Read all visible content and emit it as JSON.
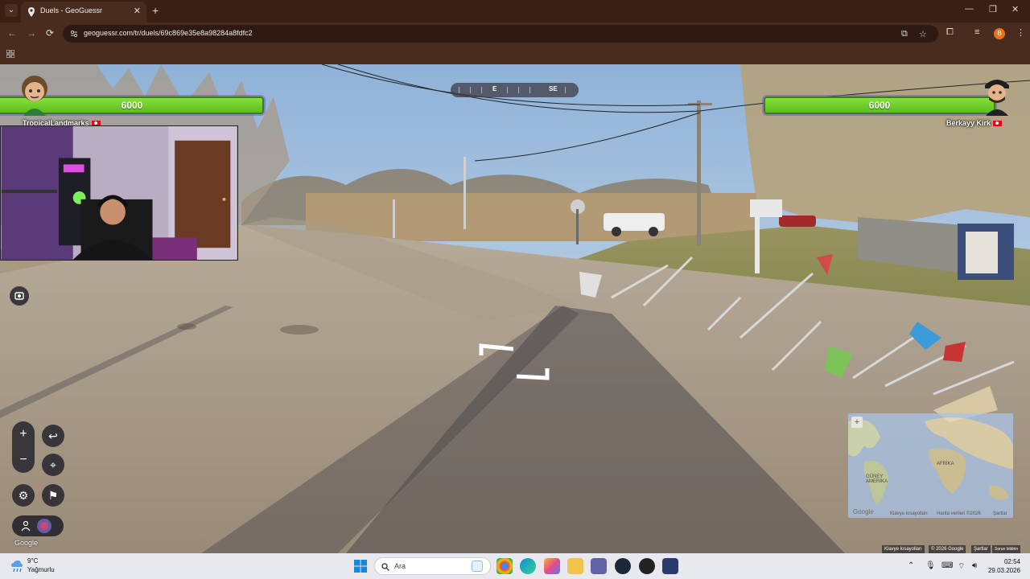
{
  "browser": {
    "tab_title": "Duels - GeoGuessr",
    "tab_close": "✕",
    "new_tab": "+",
    "url": "geoguessr.com/tr/duels/69c869e35e8a98284a8fdfc2",
    "profile_initial": "B",
    "window_controls": [
      "—",
      "❐",
      "✕"
    ]
  },
  "game": {
    "compass": [
      "E",
      "SE"
    ],
    "player_left": {
      "health": "6000",
      "name": "TropicalLandmarks",
      "flag": "tr"
    },
    "player_right": {
      "health": "6000",
      "name": "Berkayy Kirk",
      "flag": "tr"
    },
    "controls": {
      "zoom_in": "+",
      "zoom_out": "−",
      "undo": "↩",
      "checkpoint": "⌖",
      "settings": "⚙",
      "flag_start": "⚑"
    },
    "google_watermark": "Google",
    "minimap": {
      "labels": [
        "AFRİKA",
        "GÜNEY AMERİKA"
      ],
      "footer": [
        "Google",
        "Klavye kısayolları",
        "Harita verileri ©2026",
        "Şartlar"
      ],
      "plus": "+"
    },
    "credits": [
      "Klavye kısayolları",
      "© 2026 Google",
      "Şartlar",
      "Sorun bildirin"
    ]
  },
  "taskbar": {
    "temperature": "9°C",
    "condition": "Yağmurlu",
    "search_placeholder": "Ara",
    "time": "02:54",
    "date": "29.03.2026",
    "tray_chevron": "⌃"
  },
  "colors": {
    "health_bar": "#6bcf2a",
    "chrome_bg": "#4a2c1f"
  }
}
